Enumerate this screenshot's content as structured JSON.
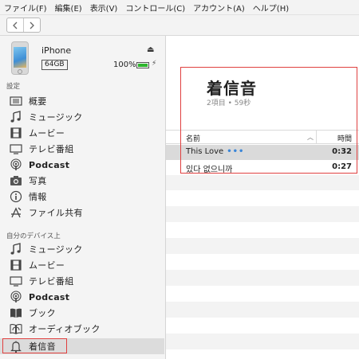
{
  "menu": [
    "ファイル(F)",
    "編集(E)",
    "表示(V)",
    "コントロール(C)",
    "アカウント(A)",
    "ヘルプ(H)"
  ],
  "device": {
    "name": "iPhone",
    "capacity": "64GB",
    "battery_text": "100%",
    "battery_level": 1.0
  },
  "sidebar": {
    "settings_title": "設定",
    "settings_items": [
      {
        "label": "概要",
        "icon": "summary-icon"
      },
      {
        "label": "ミュージック",
        "icon": "music-note-icon"
      },
      {
        "label": "ムービー",
        "icon": "film-icon"
      },
      {
        "label": "テレビ番組",
        "icon": "tv-icon"
      },
      {
        "label": "Podcast",
        "icon": "podcast-icon"
      },
      {
        "label": "写真",
        "icon": "camera-icon"
      },
      {
        "label": "情報",
        "icon": "info-icon"
      },
      {
        "label": "ファイル共有",
        "icon": "apps-icon"
      }
    ],
    "ondevice_title": "自分のデバイス上",
    "ondevice_items": [
      {
        "label": "ミュージック",
        "icon": "music-note-icon"
      },
      {
        "label": "ムービー",
        "icon": "film-icon"
      },
      {
        "label": "テレビ番組",
        "icon": "tv-icon"
      },
      {
        "label": "Podcast",
        "icon": "podcast-icon"
      },
      {
        "label": "ブック",
        "icon": "book-icon"
      },
      {
        "label": "オーディオブック",
        "icon": "audiobook-icon"
      },
      {
        "label": "着信音",
        "icon": "bell-icon"
      }
    ]
  },
  "main": {
    "title": "着信音",
    "subtitle": "2項目 • 59秒",
    "columns": {
      "name": "名前",
      "time": "時間"
    },
    "rows": [
      {
        "name": "This Love",
        "more": "•••",
        "time": "0:32"
      },
      {
        "name": "있다 없으니까",
        "more": "",
        "time": "0:27"
      }
    ]
  },
  "colors": {
    "accent_red": "#e0403f",
    "battery_green": "#2db52d",
    "dots_blue": "#3b86d8"
  }
}
